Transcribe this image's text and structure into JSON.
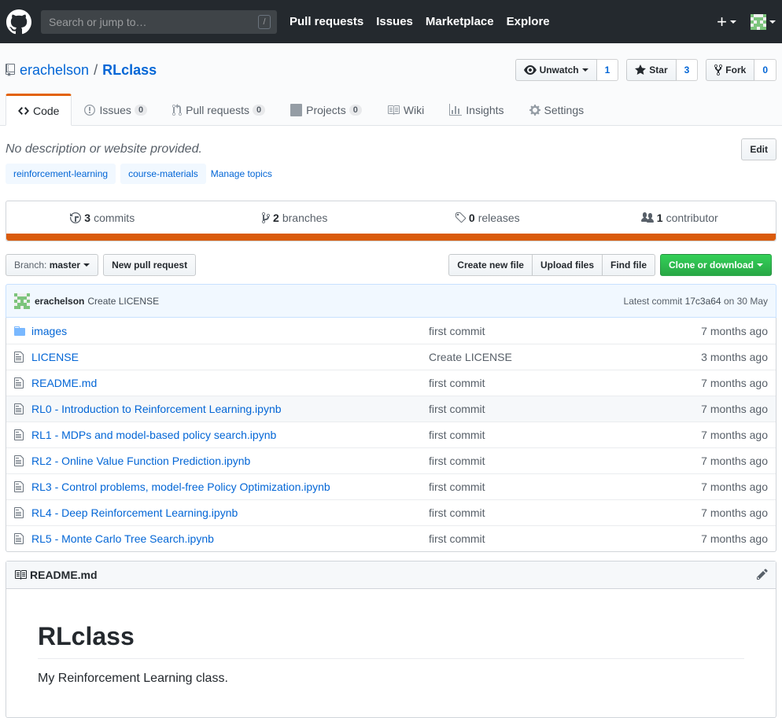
{
  "header": {
    "search_placeholder": "Search or jump to…",
    "search_shortcut": "/",
    "nav": [
      "Pull requests",
      "Issues",
      "Marketplace",
      "Explore"
    ],
    "new_label": "+"
  },
  "repo": {
    "owner": "erachelson",
    "separator": "/",
    "name": "RLclass",
    "actions": {
      "watch_label": "Unwatch",
      "watch_count": "1",
      "star_label": "Star",
      "star_count": "3",
      "fork_label": "Fork",
      "fork_count": "0"
    }
  },
  "tabs": [
    {
      "label": "Code",
      "counter": null
    },
    {
      "label": "Issues",
      "counter": "0"
    },
    {
      "label": "Pull requests",
      "counter": "0"
    },
    {
      "label": "Projects",
      "counter": "0"
    },
    {
      "label": "Wiki",
      "counter": null
    },
    {
      "label": "Insights",
      "counter": null
    },
    {
      "label": "Settings",
      "counter": null
    }
  ],
  "description": "No description or website provided.",
  "edit_label": "Edit",
  "topics": [
    "reinforcement-learning",
    "course-materials"
  ],
  "manage_topics": "Manage topics",
  "summary": {
    "commits_count": "3",
    "commits_label": "commits",
    "branches_count": "2",
    "branches_label": "branches",
    "releases_count": "0",
    "releases_label": "releases",
    "contributors_count": "1",
    "contributors_label": "contributor",
    "language_color": "#DA5B0B"
  },
  "file_nav": {
    "branch_prefix": "Branch:",
    "branch": "master",
    "new_pr": "New pull request",
    "create_file": "Create new file",
    "upload_files": "Upload files",
    "find_file": "Find file",
    "clone": "Clone or download"
  },
  "latest_commit": {
    "author": "erachelson",
    "message": "Create LICENSE",
    "prefix": "Latest commit",
    "sha": "17c3a64",
    "date": "on 30 May"
  },
  "files": [
    {
      "type": "folder",
      "name": "images",
      "message": "first commit",
      "age": "7 months ago"
    },
    {
      "type": "file",
      "name": "LICENSE",
      "message": "Create LICENSE",
      "age": "3 months ago"
    },
    {
      "type": "file",
      "name": "README.md",
      "message": "first commit",
      "age": "7 months ago"
    },
    {
      "type": "file",
      "name": "RL0 - Introduction to Reinforcement Learning.ipynb",
      "message": "first commit",
      "age": "7 months ago"
    },
    {
      "type": "file",
      "name": "RL1 - MDPs and model-based policy search.ipynb",
      "message": "first commit",
      "age": "7 months ago"
    },
    {
      "type": "file",
      "name": "RL2 - Online Value Function Prediction.ipynb",
      "message": "first commit",
      "age": "7 months ago"
    },
    {
      "type": "file",
      "name": "RL3 - Control problems, model-free Policy Optimization.ipynb",
      "message": "first commit",
      "age": "7 months ago"
    },
    {
      "type": "file",
      "name": "RL4 - Deep Reinforcement Learning.ipynb",
      "message": "first commit",
      "age": "7 months ago"
    },
    {
      "type": "file",
      "name": "RL5 - Monte Carlo Tree Search.ipynb",
      "message": "first commit",
      "age": "7 months ago"
    }
  ],
  "readme": {
    "filename": "README.md",
    "heading": "RLclass",
    "text": "My Reinforcement Learning class."
  }
}
